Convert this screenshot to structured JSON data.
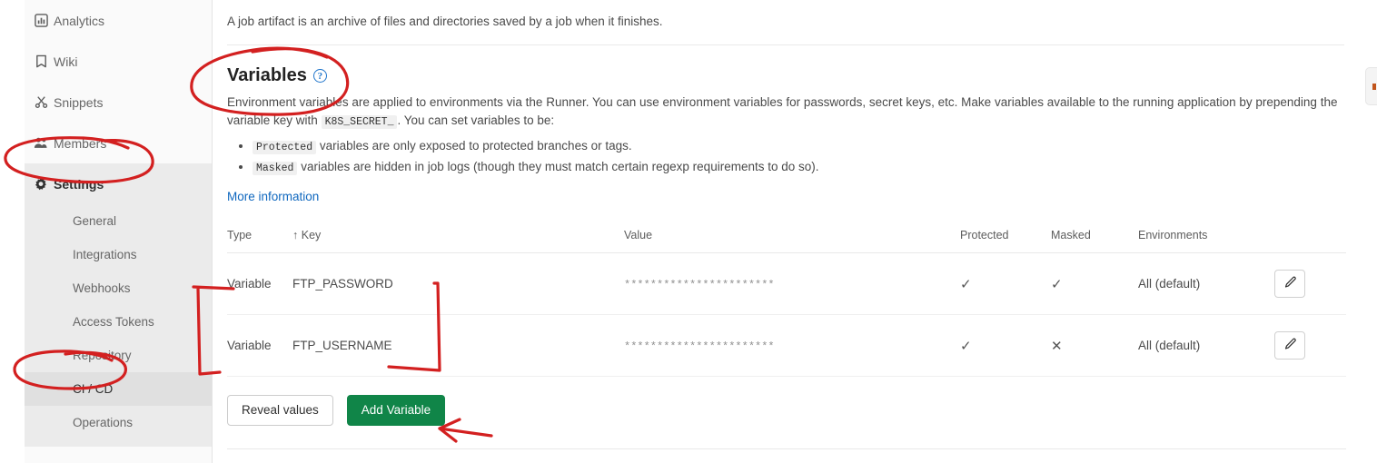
{
  "sidebar": {
    "main_items": [
      {
        "label": "Analytics",
        "icon": "analytics-icon",
        "active": false
      },
      {
        "label": "Wiki",
        "icon": "wiki-icon",
        "active": false
      },
      {
        "label": "Snippets",
        "icon": "snippets-icon",
        "active": false
      },
      {
        "label": "Members",
        "icon": "members-icon",
        "active": false
      },
      {
        "label": "Settings",
        "icon": "gear-icon",
        "active": true
      }
    ],
    "sub_items": [
      {
        "label": "General",
        "active": false
      },
      {
        "label": "Integrations",
        "active": false
      },
      {
        "label": "Webhooks",
        "active": false
      },
      {
        "label": "Access Tokens",
        "active": false
      },
      {
        "label": "Repository",
        "active": false
      },
      {
        "label": "CI / CD",
        "active": true
      },
      {
        "label": "Operations",
        "active": false
      }
    ]
  },
  "main": {
    "artifact_lead": "A job artifact is an archive of files and directories saved by a job when it finishes.",
    "section_title": "Variables",
    "help_icon_glyph": "?",
    "description_part1": "Environment variables are applied to environments via the Runner. You can use environment variables for passwords, secret keys, etc. Make variables available to the running application by prepending the variable key with",
    "description_code": "K8S_SECRET_",
    "description_part2": ". You can set variables to be:",
    "bullets": [
      {
        "code": "Protected",
        "text": "variables are only exposed to protected branches or tags."
      },
      {
        "code": "Masked",
        "text": "variables are hidden in job logs (though they must match certain regexp requirements to do so)."
      }
    ],
    "more_information_link": "More information"
  },
  "table": {
    "columns": [
      {
        "label": "Type",
        "sorted": false
      },
      {
        "label": "Key",
        "sorted": true,
        "sort_glyph": "↑"
      },
      {
        "label": "Value",
        "sorted": false
      },
      {
        "label": "Protected",
        "sorted": false
      },
      {
        "label": "Masked",
        "sorted": false
      },
      {
        "label": "Environments",
        "sorted": false
      },
      {
        "label": "",
        "sorted": false
      }
    ],
    "rows": [
      {
        "type": "Variable",
        "key": "FTP_PASSWORD",
        "value": "***********************",
        "protected": "✓",
        "masked": "✓",
        "environments": "All (default)",
        "edit_icon": "pencil-icon"
      },
      {
        "type": "Variable",
        "key": "FTP_USERNAME",
        "value": "***********************",
        "protected": "✓",
        "masked": "✕",
        "environments": "All (default)",
        "edit_icon": "pencil-icon"
      }
    ]
  },
  "actions": {
    "reveal_values_label": "Reveal values",
    "add_variable_label": "Add Variable"
  },
  "colors": {
    "primary_green": "#108548",
    "link_blue": "#1068bf",
    "help_blue": "#1f75cb",
    "annotation_red": "#d32020",
    "sidebar_bg": "#fafafa",
    "subnav_bg": "#ebebeb"
  }
}
